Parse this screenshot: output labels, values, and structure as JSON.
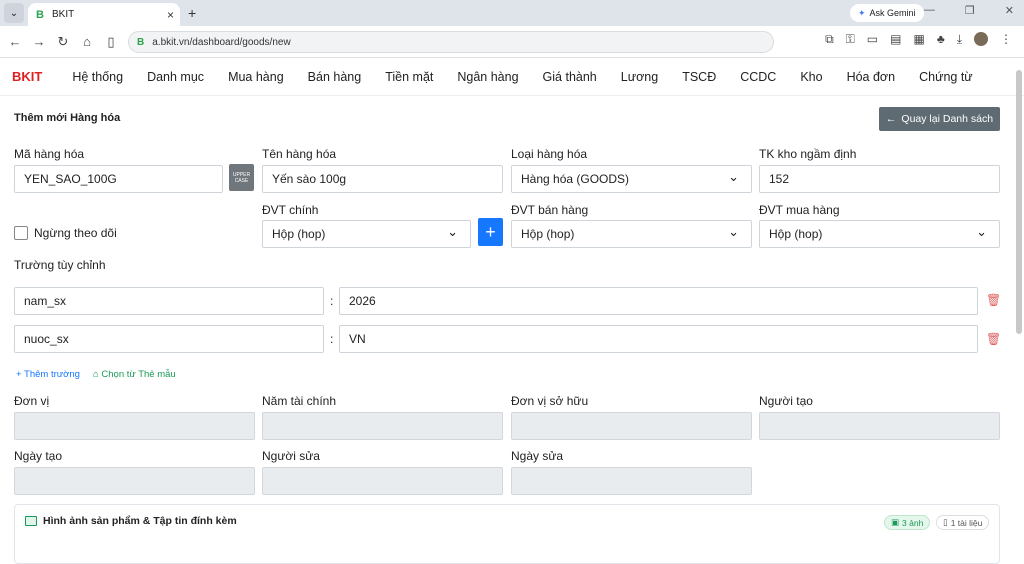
{
  "browser": {
    "tab_title": "BKIT",
    "favicon": "B",
    "gemini": "Ask Gemini",
    "url": "a.bkit.vn/dashboard/goods/new"
  },
  "app": {
    "brand": "BKIT",
    "menu": [
      "Hệ thống",
      "Danh mục",
      "Mua hàng",
      "Bán hàng",
      "Tiền mặt",
      "Ngân hàng",
      "Giá thành",
      "Lương",
      "TSCĐ",
      "CCDC",
      "Kho",
      "Hóa đơn",
      "Chứng từ"
    ]
  },
  "page": {
    "title": "Thêm mới Hàng hóa",
    "back_label": "Quay lại Danh sách"
  },
  "form": {
    "code_label": "Mã hàng hóa",
    "code_value": "YEN_SAO_100G",
    "upper_label": "UPPER CASE",
    "name_label": "Tên hàng hóa",
    "name_value": "Yến sào 100g",
    "type_label": "Loại hàng hóa",
    "type_value": "Hàng hóa (GOODS)",
    "account_label": "TK kho ngầm định",
    "account_value": "152",
    "unit_main_label": "ĐVT chính",
    "unit_main_value": "Hộp (hop)",
    "unit_sell_label": "ĐVT bán hàng",
    "unit_sell_value": "Hộp (hop)",
    "unit_buy_label": "ĐVT mua hàng",
    "unit_buy_value": "Hộp (hop)",
    "inactive_label": "Ngừng theo dõi",
    "custom_label": "Trường tùy chỉnh",
    "custom_fields": [
      {
        "key": "nam_sx",
        "value": "2026"
      },
      {
        "key": "nuoc_sx",
        "value": "VN"
      }
    ],
    "add_field": "Thêm trường",
    "pick_template": "Chọn từ Thẻ mẫu",
    "unit_label": "Đơn vị",
    "fiscal_year_label": "Năm tài chính",
    "owner_unit_label": "Đơn vị sở hữu",
    "creator_label": "Người tạo",
    "created_date_label": "Ngày tạo",
    "editor_label": "Người sửa",
    "edited_date_label": "Ngày sửa"
  },
  "attachments": {
    "title": "Hình ảnh sản phẩm & Tập tin đính kèm",
    "images_badge": "3 ảnh",
    "files_badge": "1 tài liệu"
  },
  "colors": {
    "brand": "#e02020",
    "primary": "#1677ff",
    "back_button": "#5f6b73"
  }
}
